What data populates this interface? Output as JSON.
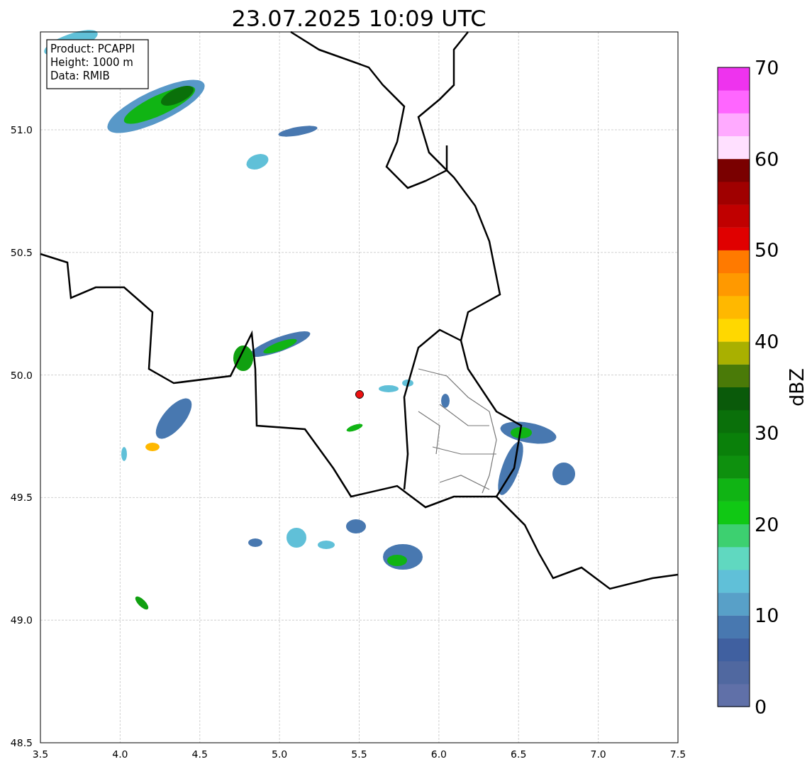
{
  "title": "23.07.2025 10:09 UTC",
  "info_box": [
    "Product: PCAPPI",
    "Height: 1000 m",
    "Data: RMIB"
  ],
  "x_ticks": [
    "3.5",
    "4.0",
    "4.5",
    "5.0",
    "5.5",
    "6.0",
    "6.5",
    "7.0",
    "7.5"
  ],
  "y_ticks": [
    "51.0",
    "50.5",
    "50.0",
    "49.5",
    "49.0",
    "48.5"
  ],
  "colorbar": {
    "label": "dBZ",
    "ticks": [
      "70",
      "60",
      "50",
      "40",
      "30",
      "20",
      "10",
      "0"
    ],
    "segments": [
      {
        "color": "#6070a8"
      },
      {
        "color": "#5068a0"
      },
      {
        "color": "#4060a0"
      },
      {
        "color": "#4878b0"
      },
      {
        "color": "#58a0c8"
      },
      {
        "color": "#60c0d8"
      },
      {
        "color": "#60d8c0"
      },
      {
        "color": "#3dd070"
      },
      {
        "color": "#10c814"
      },
      {
        "color": "#10b414"
      },
      {
        "color": "#0e900e"
      },
      {
        "color": "#0a800a"
      },
      {
        "color": "#0a700a"
      },
      {
        "color": "#0a5a0a"
      },
      {
        "color": "#4a7a08"
      },
      {
        "color": "#a9b000"
      },
      {
        "color": "#ffd800"
      },
      {
        "color": "#ffb800"
      },
      {
        "color": "#ff9900"
      },
      {
        "color": "#ff7a00"
      },
      {
        "color": "#e00000"
      },
      {
        "color": "#c00000"
      },
      {
        "color": "#a00000"
      },
      {
        "color": "#7a0000"
      },
      {
        "color": "#ffe0ff"
      },
      {
        "color": "#ffaaff"
      },
      {
        "color": "#ff66ff"
      },
      {
        "color": "#ee33ee"
      }
    ]
  }
}
